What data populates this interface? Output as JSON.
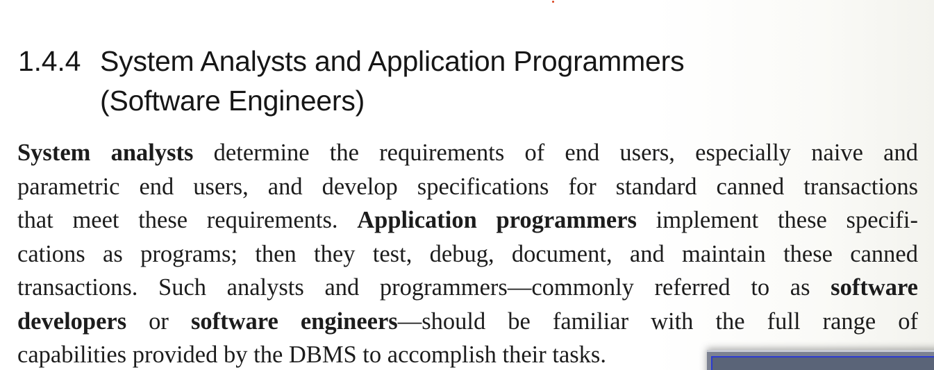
{
  "section": {
    "number": "1.4.4",
    "title_line_1": "System Analysts and Application Programmers",
    "title_line_2": "(Software Engineers)"
  },
  "paragraph": {
    "l1_bold": "System analysts",
    "l1_rest": " determine the requirements of end users, especially naive and",
    "l2": "parametric end users, and develop specifications for standard canned transactions",
    "l3_pre": "that meet these requirements. ",
    "l3_bold": "Application programmers",
    "l3_post": " implement these specifi-",
    "l4": "cations as programs; then they test, debug, document, and maintain these canned",
    "l5_pre": "transactions. Such analysts and programmers—commonly referred to as ",
    "l5_bold": "software",
    "l6_bold_1": "developers",
    "l6_mid": " or ",
    "l6_bold_2": "software engineers",
    "l6_post": "—should be familiar with the full range of",
    "l7": "capabilities provided by the DBMS to accomplish their tasks."
  },
  "colors": {
    "text": "#1c1c1c",
    "overlay_border": "#2b3bd0"
  }
}
